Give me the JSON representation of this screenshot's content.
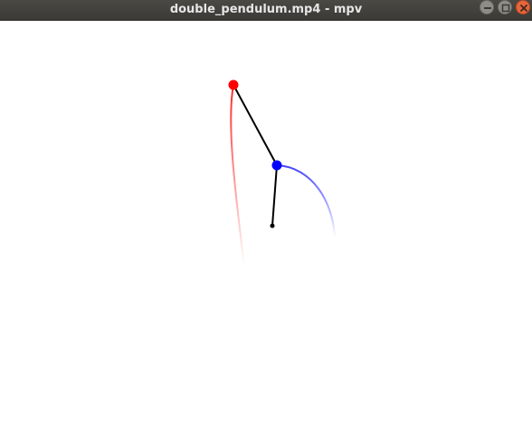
{
  "window": {
    "title": "double_pendulum.mp4 - mpv",
    "controls": [
      "minimize-icon",
      "maximize-icon",
      "close-icon"
    ]
  },
  "video_frame": {
    "background": "#ffffff",
    "rod_color": "#000000",
    "bob1_color": "#ff0000",
    "bob2_color": "#0000ff",
    "trail1_color": "#ff0000",
    "trail2_color": "#0000ff"
  }
}
